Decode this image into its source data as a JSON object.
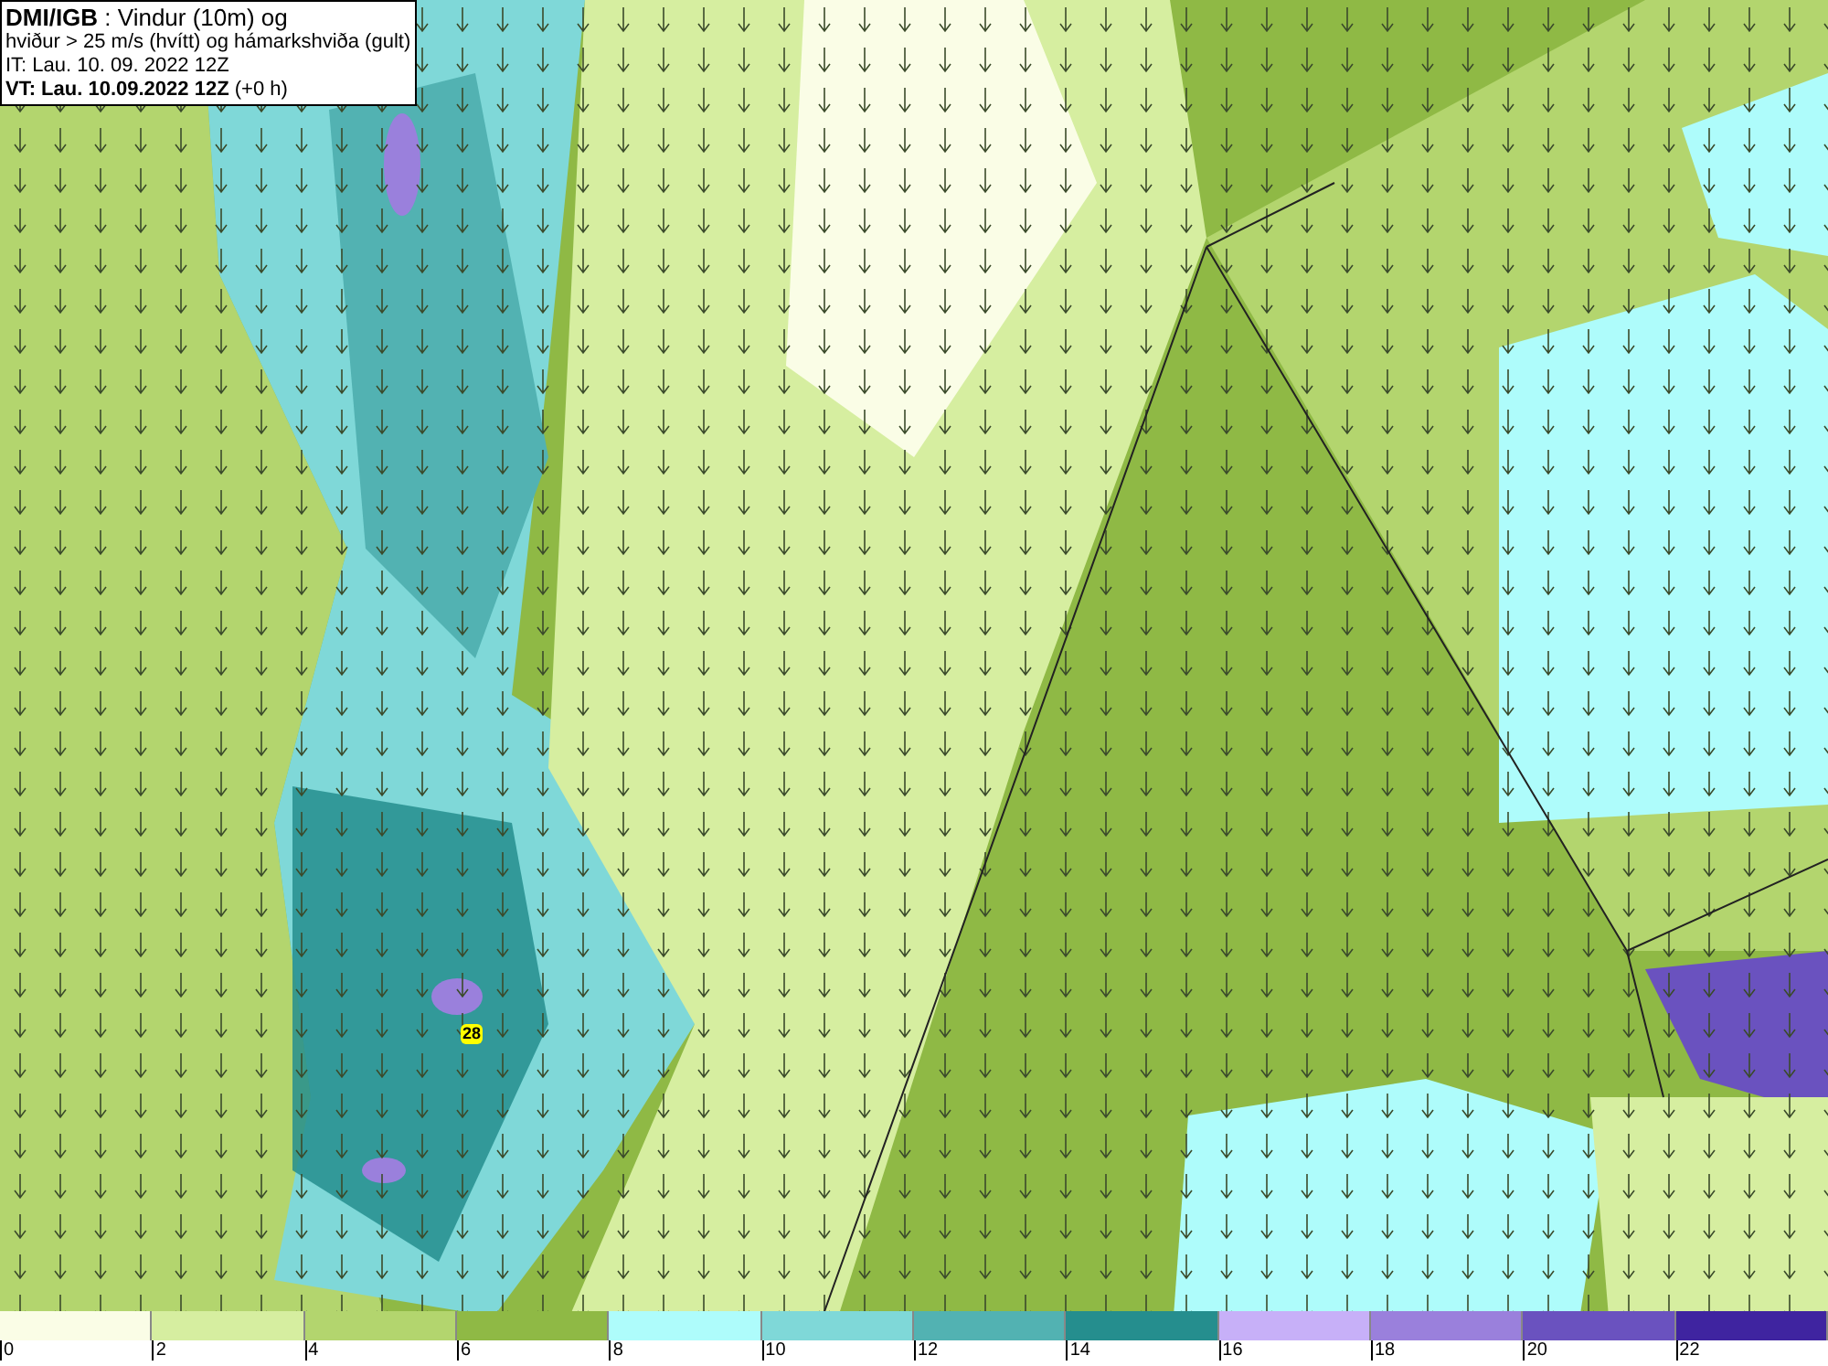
{
  "header": {
    "lines": [
      "**DMI/IGB** : Vindur (10m) og",
      "hviður > 25 m/s (hvítt) og hámarkshviða (gult)",
      "IT: Lau. 10. 09. 2022 12Z",
      "**VT: Lau. 10.09.2022 12Z** (+0 h)"
    ]
  },
  "gust_marker": {
    "label": "28"
  },
  "legend": {
    "bins": [
      {
        "label": "0",
        "color": "#fafde6"
      },
      {
        "label": "2",
        "color": "#d6eea0"
      },
      {
        "label": "4",
        "color": "#b3d56e"
      },
      {
        "label": "6",
        "color": "#8fb945"
      },
      {
        "label": "8",
        "color": "#aefcfb"
      },
      {
        "label": "10",
        "color": "#7fd8d8"
      },
      {
        "label": "12",
        "color": "#52b2b2"
      },
      {
        "label": "14",
        "color": "#258e8e"
      },
      {
        "label": "16",
        "color": "#c7b0f8"
      },
      {
        "label": "18",
        "color": "#9a80dc"
      },
      {
        "label": "20",
        "color": "#6a52bf"
      },
      {
        "label": "22",
        "color": "#3f24a0"
      }
    ]
  }
}
